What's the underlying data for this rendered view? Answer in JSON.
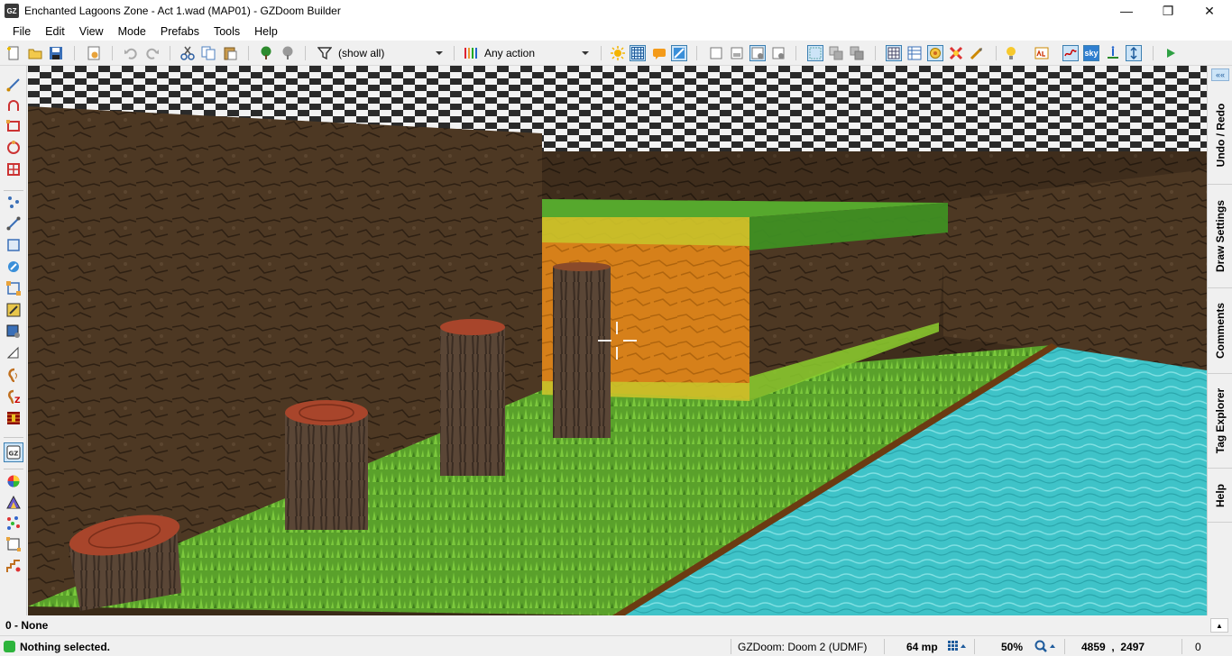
{
  "window": {
    "title": "Enchanted Lagoons Zone - Act 1.wad (MAP01) - GZDoom Builder",
    "app_icon_text": "GZ",
    "minimize": "—",
    "maximize": "❐",
    "close": "✕"
  },
  "menu": [
    "File",
    "Edit",
    "View",
    "Mode",
    "Prefabs",
    "Tools",
    "Help"
  ],
  "toolbar": {
    "filter_value": "(show all)",
    "action_value": "Any action",
    "sky_label": "sky",
    "icons": [
      "new-map-icon",
      "open-map-icon",
      "save-map-icon",
      "map-options-icon",
      "undo-icon",
      "redo-icon",
      "cut-icon",
      "copy-icon",
      "paste-icon",
      "insert-prefab-icon",
      "insert-previous-prefab-icon",
      "filter-icon",
      "action-filter-icon",
      "full-brightness-icon",
      "grid-icon",
      "event-lines-icon",
      "visual-slope-icon",
      "models-icon",
      "lights-icon",
      "test-map-icon"
    ]
  },
  "viewport": {
    "colors": {
      "water": "#3fc3c8",
      "grass": "#5aa02a",
      "dirt": "#4a3622",
      "orange": "#d6801a"
    }
  },
  "rightdock": {
    "tabs": [
      "Undo / Redo",
      "Draw Settings",
      "Comments",
      "Tag Explorer",
      "Help"
    ],
    "collapse_icon": "««"
  },
  "infobar": {
    "text": "0 - None",
    "collapse_icon": "▲"
  },
  "statusbar": {
    "message": "Nothing selected.",
    "engine": "GZDoom: Doom 2 (UDMF)",
    "grid_size": "64 mp",
    "zoom": "50%",
    "coordinates": "4859  ,  2497",
    "extra": "0"
  }
}
